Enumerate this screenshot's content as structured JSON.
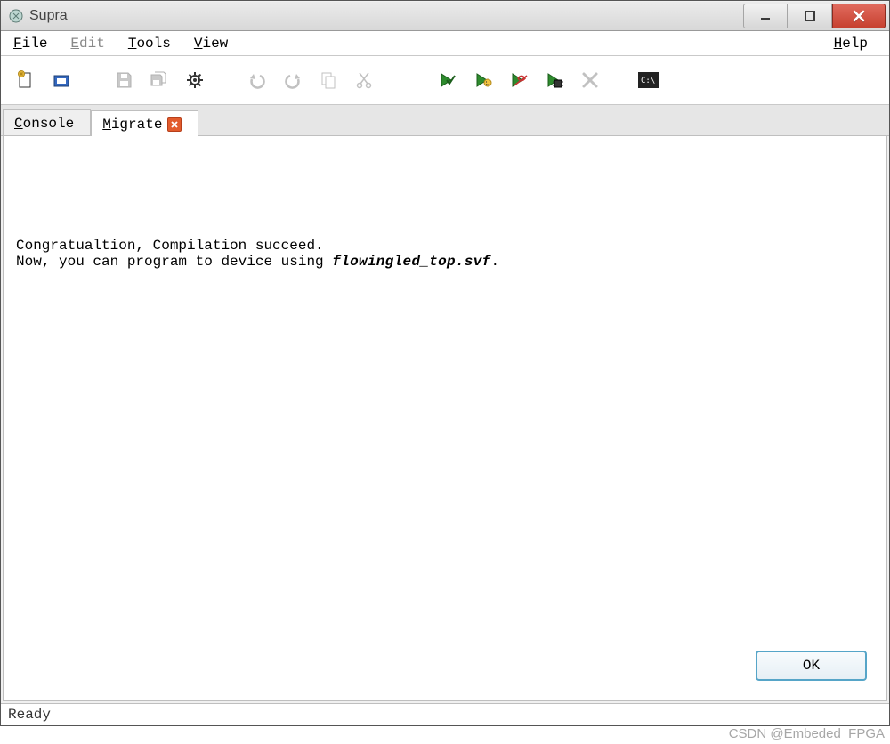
{
  "window": {
    "title": "Supra"
  },
  "menu": {
    "file": "File",
    "edit": "Edit",
    "tools": "Tools",
    "view": "View",
    "help": "Help"
  },
  "toolbar": {
    "icons": [
      "new-file-icon",
      "open-project-icon",
      "save-icon",
      "save-all-icon",
      "settings-icon",
      "undo-icon",
      "redo-icon",
      "copy-icon",
      "cut-icon",
      "run-check-icon",
      "run-smile-icon",
      "run-wave-icon",
      "run-chip-icon",
      "stop-icon",
      "terminal-icon"
    ]
  },
  "tabs": [
    {
      "label": "Console"
    },
    {
      "label": "Migrate",
      "active": true,
      "closable": true
    }
  ],
  "message": {
    "line1": "Congratualtion, Compilation succeed.",
    "line2_prefix": "Now, you can program to device using ",
    "line2_file": "flowingled_top.svf",
    "line2_suffix": "."
  },
  "buttons": {
    "ok": "OK"
  },
  "status": {
    "text": "Ready"
  },
  "watermark": "CSDN @Embeded_FPGA"
}
